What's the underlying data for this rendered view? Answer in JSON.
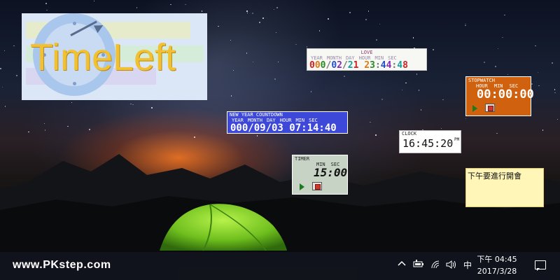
{
  "logo": {
    "text": "TimeLeft"
  },
  "love_widget": {
    "title": "LOVE",
    "headers": [
      "YEAR",
      "MONTH",
      "DAY",
      "HOUR",
      "MIN",
      "SEC"
    ],
    "value": "000/02/21 23:44:48"
  },
  "stopwatch_widget": {
    "title": "STOPWATCH",
    "headers": [
      "HOUR",
      "MIN",
      "SEC"
    ],
    "value": "00:00:00"
  },
  "newyear_widget": {
    "title": "NEW YEAR COUNTDOWN",
    "headers": [
      "YEAR",
      "MONTH",
      "DAY",
      "HOUR",
      "MIN",
      "SEC"
    ],
    "value": "000/09/03 07:14:40"
  },
  "clock_widget": {
    "title": "CLOCK",
    "value": "16:45:20",
    "ampm": "PM"
  },
  "timer_widget": {
    "title": "TIMER",
    "headers": [
      "MIN",
      "SEC"
    ],
    "value": "15:00"
  },
  "note": {
    "text": "下午要進行開會"
  },
  "taskbar": {
    "watermark": "www.PKstep.com",
    "ime": "中",
    "time": "下午 04:45",
    "date": "2017/3/28"
  },
  "colors": {
    "stopwatch_bg": "#d0620f",
    "newyear_bg": "#3e48d8",
    "timer_bg": "#c7d4c5",
    "note_bg": "#fff6b8"
  }
}
